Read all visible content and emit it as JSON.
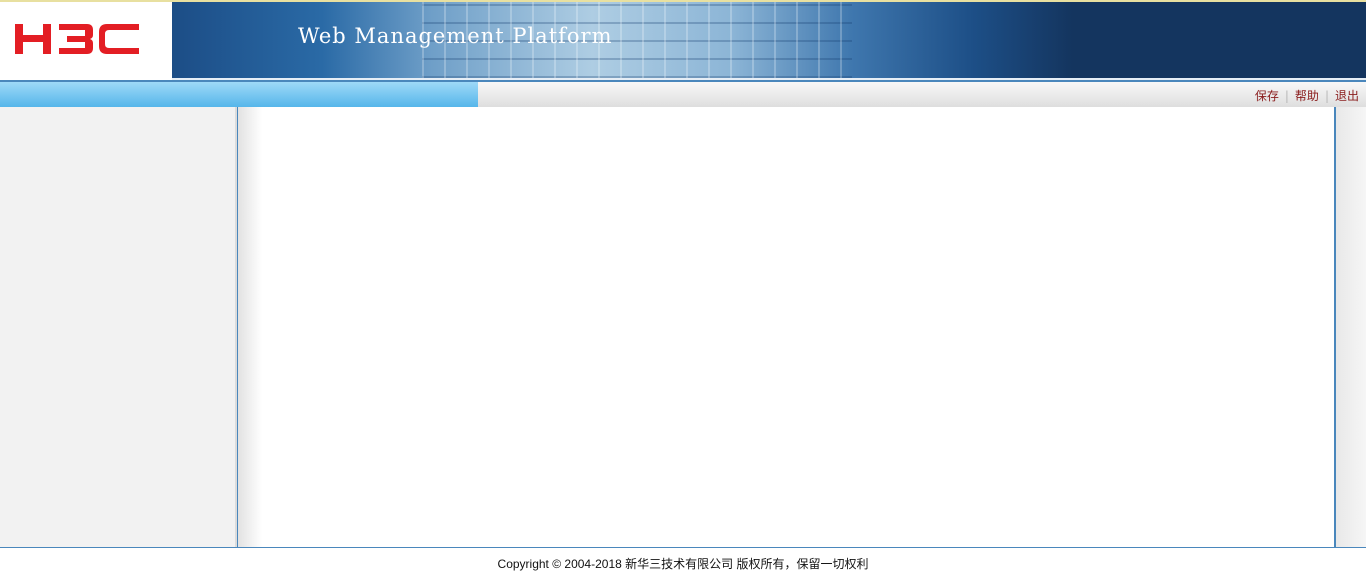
{
  "header": {
    "logo_text": "H3C",
    "banner_title": "Web Management Platform",
    "logo_color": "#e31e24",
    "banner_color": "#14355f"
  },
  "nav": {
    "links": [
      "保存",
      "帮助",
      "退出"
    ],
    "link_color": "#8a1c1c",
    "accent_color": "#56b6ea"
  },
  "footer": {
    "copyright": "Copyright © 2004-2018 新华三技术有限公司 版权所有，保留一切权利"
  }
}
